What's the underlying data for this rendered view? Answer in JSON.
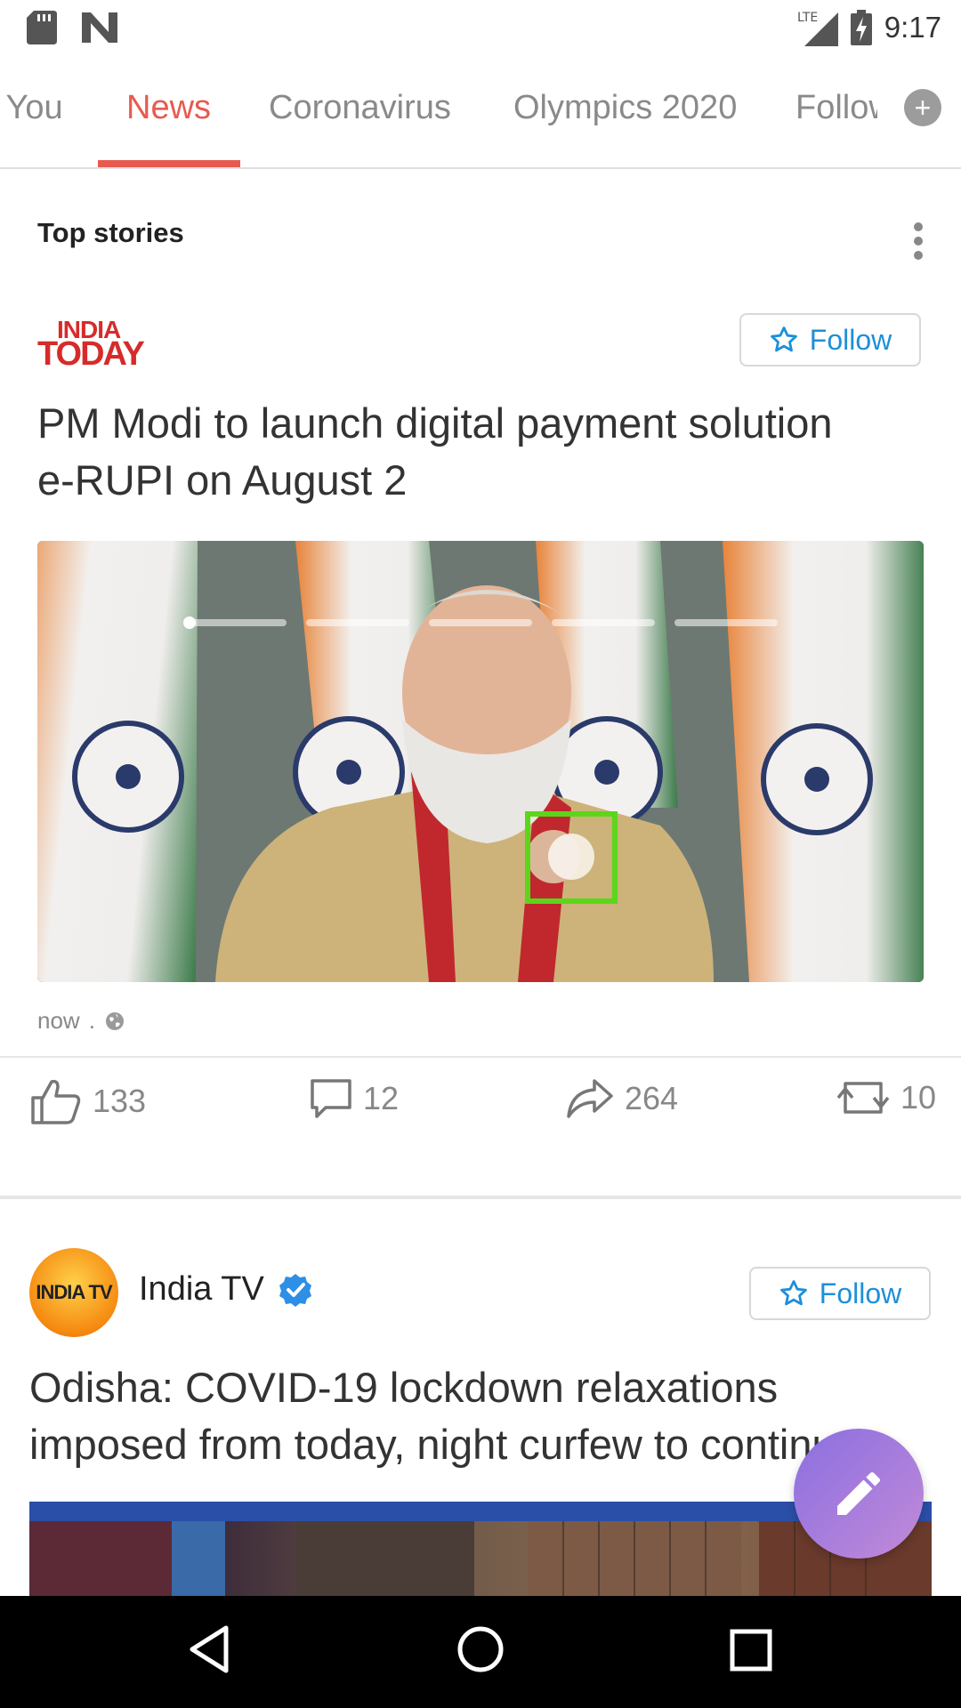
{
  "status_bar": {
    "time": "9:17",
    "network": "LTE"
  },
  "tabs": [
    {
      "label": "r You"
    },
    {
      "label": "News",
      "active": true
    },
    {
      "label": "Coronavirus"
    },
    {
      "label": "Olympics 2020"
    },
    {
      "label": "Follow"
    }
  ],
  "section": {
    "title": "Top stories"
  },
  "post1": {
    "source_logo_line1": "INDIA",
    "source_logo_line2": "TODAY",
    "follow_label": "Follow",
    "headline_line1": "PM Modi to launch digital payment solution",
    "headline_line2": "e-RUPI on August 2",
    "time": "now",
    "separator": ".",
    "likes": "133",
    "comments": "12",
    "shares": "264",
    "reposts": "10",
    "carousel_slides": 5,
    "carousel_active": 1
  },
  "post2": {
    "source_logo_text": "INDIA TV",
    "source_name": "India TV",
    "verified": true,
    "follow_label": "Follow",
    "headline_line1": "Odisha: COVID-19 lockdown relaxations",
    "headline_line2": "imposed from today, night curfew to continue"
  },
  "colors": {
    "accent": "#e85a50",
    "link": "#1e8fd8",
    "fab": "#a47ddc"
  },
  "icons": [
    "sd-card-icon",
    "n-logo-icon",
    "signal-icon",
    "battery-charging-icon",
    "plus-icon",
    "more-vert-icon",
    "star-icon",
    "globe-icon",
    "thumbs-up-icon",
    "comment-icon",
    "share-icon",
    "repost-icon",
    "verified-icon",
    "edit-icon",
    "back-icon",
    "home-icon",
    "recents-icon"
  ]
}
